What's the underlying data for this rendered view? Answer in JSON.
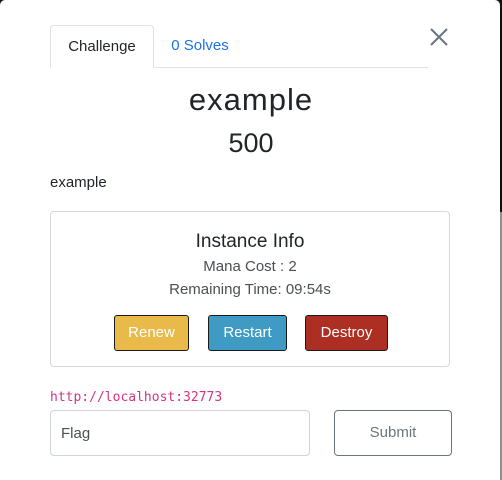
{
  "tabs": {
    "challenge_label": "Challenge",
    "solves_label": "0 Solves"
  },
  "challenge": {
    "name": "example",
    "points": "500",
    "description": "example"
  },
  "instance": {
    "title": "Instance Info",
    "mana_cost": "Mana Cost : 2",
    "remaining_time": "Remaining Time: 09:54s",
    "buttons": {
      "renew": "Renew",
      "restart": "Restart",
      "destroy": "Destroy"
    }
  },
  "connection": {
    "url": "http://localhost:32773"
  },
  "submission": {
    "flag_placeholder": "Flag",
    "submit_label": "Submit"
  },
  "icons": {
    "close": "close-icon"
  },
  "colors": {
    "renew": "#e9b949",
    "restart": "#3f9bc4",
    "destroy": "#ad2f24",
    "link": "#1a73e8",
    "url": "#d63384"
  }
}
